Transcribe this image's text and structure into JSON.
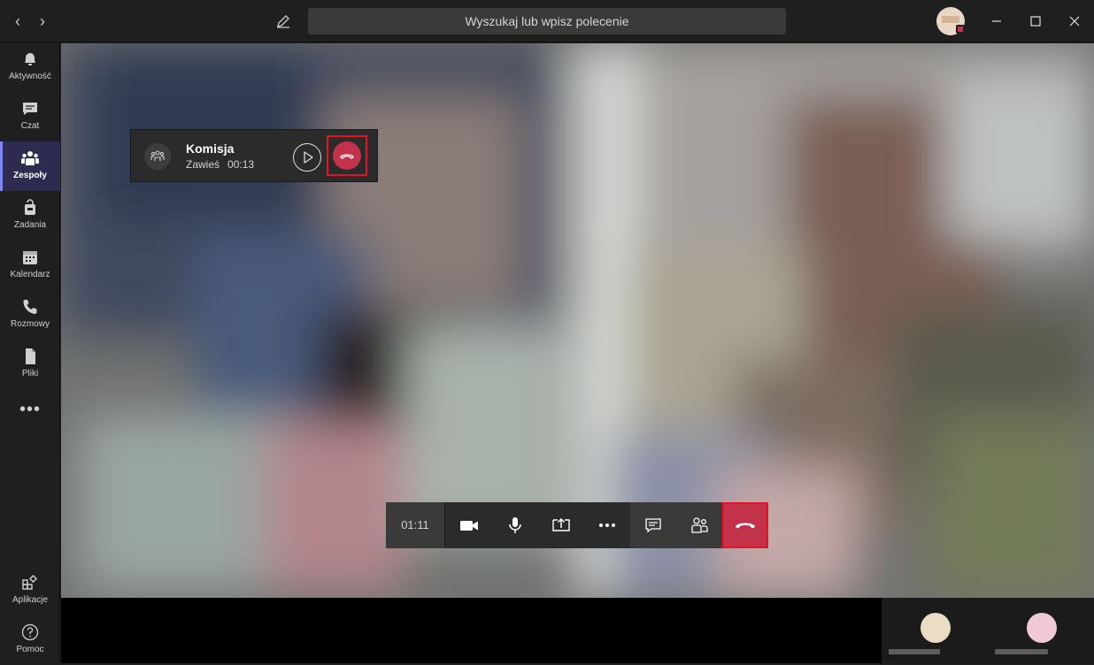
{
  "titlebar": {
    "search_placeholder": "Wyszukaj lub wpisz polecenie"
  },
  "rail": {
    "items": [
      {
        "label": "Aktywność",
        "icon": "bell-icon"
      },
      {
        "label": "Czat",
        "icon": "chat-icon"
      },
      {
        "label": "Zespoły",
        "icon": "teams-icon",
        "active": true
      },
      {
        "label": "Zadania",
        "icon": "assignments-icon"
      },
      {
        "label": "Kalendarz",
        "icon": "calendar-icon"
      },
      {
        "label": "Rozmowy",
        "icon": "phone-icon"
      },
      {
        "label": "Pliki",
        "icon": "file-icon"
      }
    ],
    "more": "•••",
    "apps_label": "Aplikacje",
    "help_label": "Pomoc"
  },
  "held_call": {
    "title": "Komisja",
    "status": "Zawieś",
    "duration": "00:13"
  },
  "controls": {
    "timer": "01:11"
  },
  "colors": {
    "accent": "#7f85f5",
    "hangup": "#c4314b",
    "highlight_border": "#e81123"
  }
}
